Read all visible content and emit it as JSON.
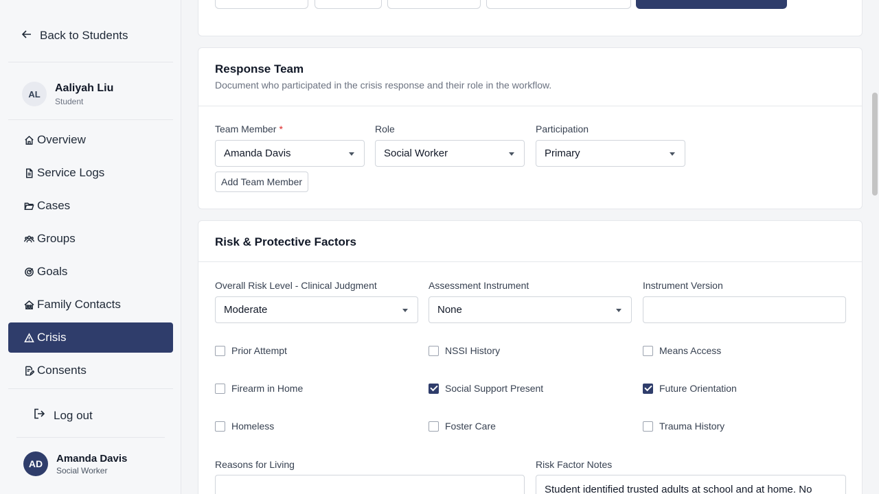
{
  "sidebar": {
    "back_label": "Back to Students",
    "student": {
      "initials": "AL",
      "name": "Aaliyah Liu",
      "role": "Student"
    },
    "items": [
      {
        "label": "Overview",
        "icon": "home-icon"
      },
      {
        "label": "Service Logs",
        "icon": "document-icon"
      },
      {
        "label": "Cases",
        "icon": "folder-icon"
      },
      {
        "label": "Groups",
        "icon": "users-icon"
      },
      {
        "label": "Goals",
        "icon": "target-icon"
      },
      {
        "label": "Family Contacts",
        "icon": "family-home-icon"
      },
      {
        "label": "Crisis",
        "icon": "warning-icon",
        "active": true
      },
      {
        "label": "Consents",
        "icon": "signature-icon"
      }
    ],
    "logout_label": "Log out",
    "user": {
      "initials": "AD",
      "name": "Amanda Davis",
      "role": "Social Worker"
    }
  },
  "team": {
    "title": "Response Team",
    "description": "Document who participated in the crisis response and their role in the workflow.",
    "member_label": "Team Member",
    "required_mark": "*",
    "member_value": "Amanda Davis",
    "role_label": "Role",
    "role_value": "Social Worker",
    "participation_label": "Participation",
    "participation_value": "Primary",
    "add_button": "Add Team Member"
  },
  "risk": {
    "title": "Risk & Protective Factors",
    "overall_label": "Overall Risk Level - Clinical Judgment",
    "overall_value": "Moderate",
    "instrument_label": "Assessment Instrument",
    "instrument_value": "None",
    "version_label": "Instrument Version",
    "version_value": "",
    "factors": [
      {
        "label": "Prior Attempt",
        "checked": false
      },
      {
        "label": "NSSI History",
        "checked": false
      },
      {
        "label": "Means Access",
        "checked": false
      },
      {
        "label": "Firearm in Home",
        "checked": false
      },
      {
        "label": "Social Support Present",
        "checked": true
      },
      {
        "label": "Future Orientation",
        "checked": true
      },
      {
        "label": "Homeless",
        "checked": false
      },
      {
        "label": "Foster Care",
        "checked": false
      },
      {
        "label": "Trauma History",
        "checked": false
      }
    ],
    "reasons_label": "Reasons for Living",
    "reasons_value": "",
    "notes_label": "Risk Factor Notes",
    "notes_value": "Student identified trusted adults at school and at home. No"
  },
  "colors": {
    "accent": "#2f3d6b",
    "required": "#dc2626"
  }
}
